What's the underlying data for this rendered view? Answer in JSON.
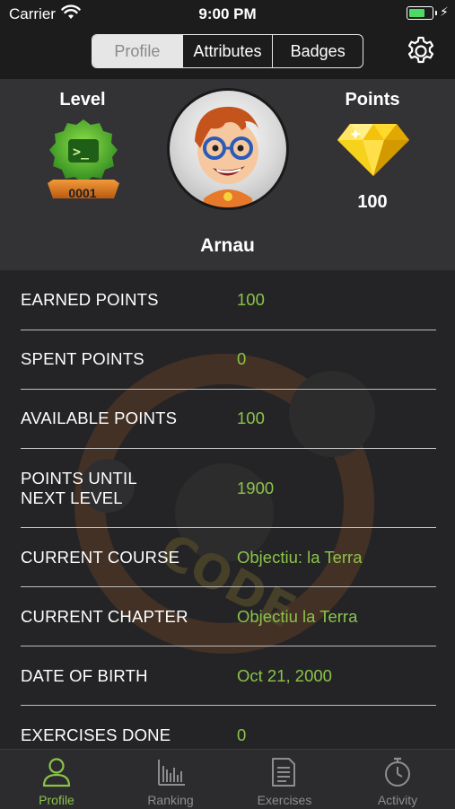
{
  "status_bar": {
    "carrier": "Carrier",
    "time": "9:00 PM",
    "battery_level": 0.65
  },
  "segments": [
    "Profile",
    "Attributes",
    "Badges"
  ],
  "selected_segment": "Profile",
  "profile": {
    "level_title": "Level",
    "level_number": "0001",
    "points_title": "Points",
    "points_value": "100",
    "username": "Arnau"
  },
  "stats": [
    {
      "label": "EARNED POINTS",
      "value": "100"
    },
    {
      "label": "SPENT POINTS",
      "value": "0"
    },
    {
      "label": "AVAILABLE POINTS",
      "value": "100"
    },
    {
      "label": "POINTS UNTIL\nNEXT LEVEL",
      "value": "1900"
    },
    {
      "label": "CURRENT COURSE",
      "value": "Objectiu: la Terra"
    },
    {
      "label": "CURRENT CHAPTER",
      "value": "Objectiu la Terra"
    },
    {
      "label": "DATE OF BIRTH",
      "value": "Oct 21, 2000"
    },
    {
      "label": "EXERCISES DONE",
      "value": "0"
    }
  ],
  "tabs": [
    {
      "label": "Profile",
      "icon": "person-icon"
    },
    {
      "label": "Ranking",
      "icon": "bar-chart-icon"
    },
    {
      "label": "Exercises",
      "icon": "document-icon"
    },
    {
      "label": "Activity",
      "icon": "stopwatch-icon"
    }
  ],
  "colors": {
    "accent": "#8bc34a",
    "background": "#1c1c1d",
    "header": "#333335"
  }
}
